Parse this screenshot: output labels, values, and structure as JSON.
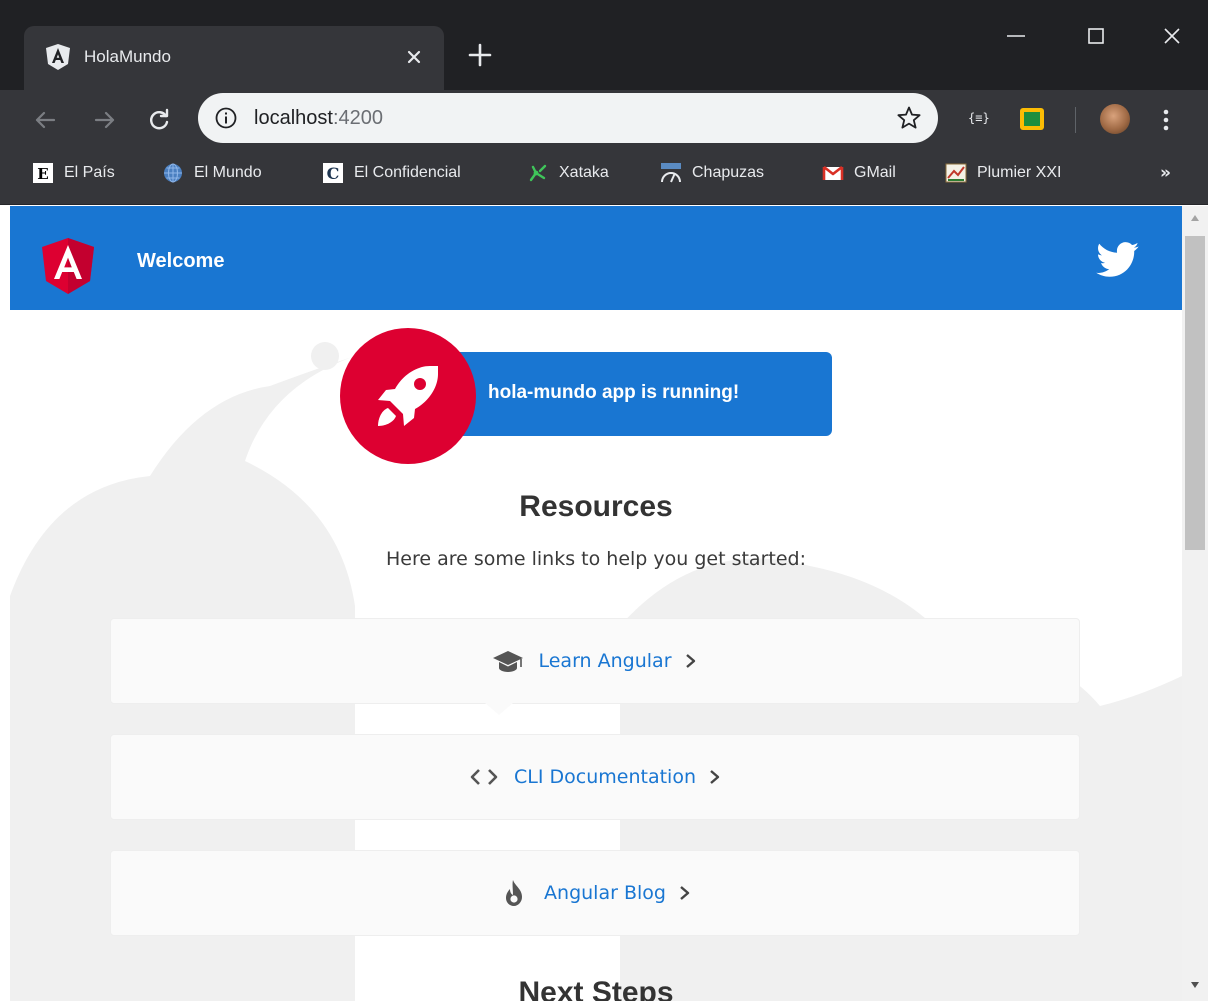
{
  "browser": {
    "tab_title": "HolaMundo",
    "url_host": "localhost",
    "url_port": ":4200",
    "extension_label": "{≡}",
    "bookmarks": [
      {
        "label": "El País",
        "icon": "elpais-icon"
      },
      {
        "label": "El Mundo",
        "icon": "globe-icon"
      },
      {
        "label": "El Confidencial",
        "icon": "elconfidencial-icon"
      },
      {
        "label": "Xataka",
        "icon": "xataka-icon"
      },
      {
        "label": "Chapuzas",
        "icon": "chapuzas-icon"
      },
      {
        "label": "GMail",
        "icon": "gmail-icon"
      },
      {
        "label": "Plumier XXI",
        "icon": "plumier-icon"
      }
    ],
    "bookmarks_more": "»"
  },
  "app": {
    "header_title": "Welcome",
    "running_message": "hola-mundo app is running!",
    "resources_title": "Resources",
    "resources_subtitle": "Here are some links to help you get started:",
    "links": [
      {
        "label": "Learn Angular",
        "icon": "graduation-cap-icon"
      },
      {
        "label": "CLI Documentation",
        "icon": "code-icon"
      },
      {
        "label": "Angular Blog",
        "icon": "flame-icon"
      }
    ],
    "next_steps_title": "Next Steps"
  },
  "colors": {
    "browser_frame": "#202124",
    "browser_toolbar": "#35363a",
    "angular_red": "#dd0031",
    "header_blue": "#1976d2",
    "link_blue": "#1976d2",
    "card_bg": "#fafafa"
  }
}
